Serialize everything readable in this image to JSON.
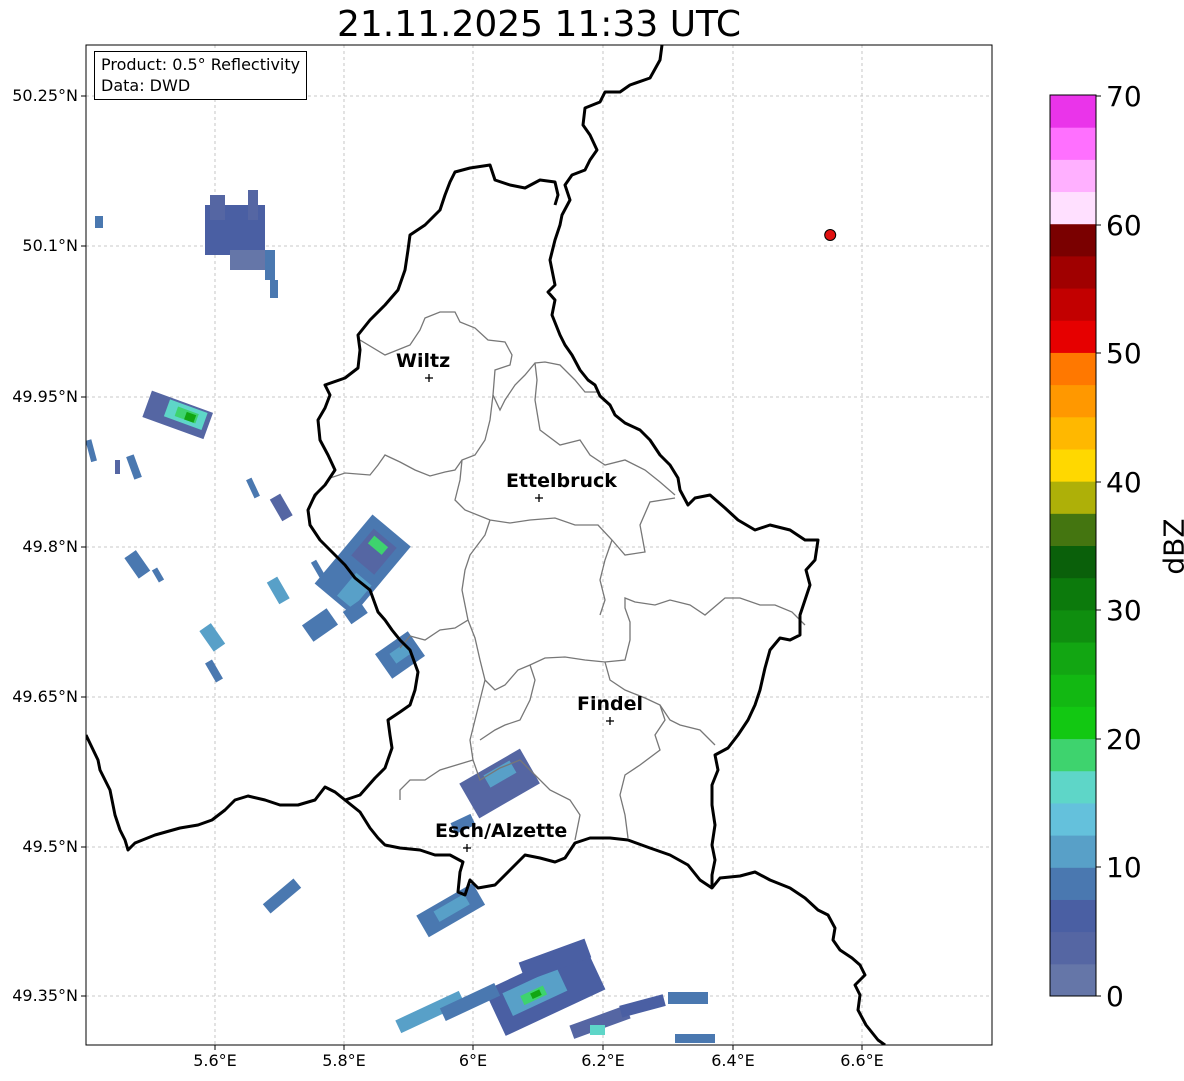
{
  "title": "21.11.2025 11:33 UTC",
  "infobox": {
    "product": "Product: 0.5° Reflectivity",
    "data": "Data: DWD"
  },
  "map": {
    "lon_range": [
      5.4,
      6.8
    ],
    "lat_range": [
      49.3,
      50.3
    ],
    "lon_ticks": [
      "5.6°E",
      "5.8°E",
      "6°E",
      "6.2°E",
      "6.4°E",
      "6.6°E"
    ],
    "lat_ticks": [
      "50.25°N",
      "50.1°N",
      "49.95°N",
      "49.8°N",
      "49.65°N",
      "49.5°N",
      "49.35°N"
    ],
    "gridlines": true,
    "marker": {
      "lon": 6.55,
      "lat": 50.11,
      "color": "#e11111"
    },
    "cities": [
      {
        "name": "Wiltz",
        "lon": 5.93,
        "lat": 49.97
      },
      {
        "name": "Ettelbruck",
        "lon": 6.1,
        "lat": 49.85
      },
      {
        "name": "Findel",
        "lon": 6.21,
        "lat": 49.63
      },
      {
        "name": "Esch/Alzette",
        "lon": 5.99,
        "lat": 49.5
      }
    ]
  },
  "colorbar": {
    "label": "dBZ",
    "ticks": [
      "0",
      "10",
      "20",
      "30",
      "40",
      "50",
      "60",
      "70"
    ],
    "min": 0,
    "max": 70,
    "step": 2.5,
    "colors": [
      "#6576a8",
      "#5566a3",
      "#4a5fa3",
      "#4a78b0",
      "#58a0c8",
      "#64c1dc",
      "#5ed6c8",
      "#3ed36e",
      "#12c812",
      "#12b812",
      "#12a612",
      "#0f8e0f",
      "#0c7a0c",
      "#0a600a",
      "#447510",
      "#aeb008",
      "#ffd800",
      "#ffb800",
      "#ff9800",
      "#ff7800",
      "#e60000",
      "#c20000",
      "#a00000",
      "#7a0000",
      "#ffe0ff",
      "#ffb0ff",
      "#ff70ff",
      "#ea34ea"
    ]
  }
}
